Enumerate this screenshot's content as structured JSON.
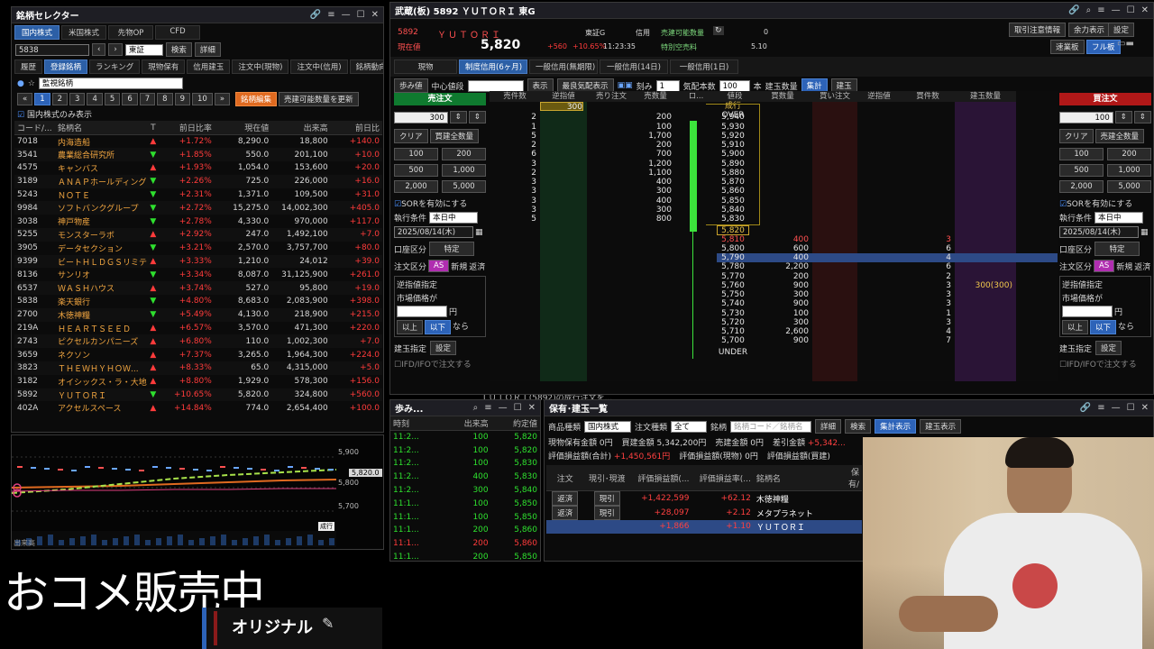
{
  "selector": {
    "title": "銘柄セレクター",
    "markets": [
      "国内株式",
      "米国株式",
      "先物OP",
      "CFD"
    ],
    "code_input": "5838",
    "exchange": "東証",
    "search_btn": "検索",
    "detail_btn": "詳細",
    "subtabs": [
      "履歴",
      "登録銘柄",
      "ランキング",
      "現物保有",
      "信用建玉",
      "注文中(現物)",
      "注文中(信用)",
      "銘柄動向速報"
    ],
    "list_name": "監視銘柄",
    "pages": [
      "1",
      "2",
      "3",
      "4",
      "5",
      "6",
      "7",
      "8",
      "9",
      "10"
    ],
    "edit_btn": "銘柄編集",
    "update_btn": "売建可能数量を更新",
    "domestic_only": "国内株式のみ表示",
    "columns": [
      "コード/...",
      "銘柄名",
      "T",
      "前日比率",
      "現在値",
      "出来高",
      "前日比"
    ],
    "rows": [
      {
        "code": "7018",
        "name": "内海造船",
        "t": "up",
        "pct": "+1.72%",
        "price": "8,290.0",
        "vol": "18,800",
        "chg": "+140.0"
      },
      {
        "code": "3541",
        "name": "農業総合研究所",
        "t": "dn",
        "pct": "+1.85%",
        "price": "550.0",
        "vol": "201,100",
        "chg": "+10.0"
      },
      {
        "code": "4575",
        "name": "キャンバス",
        "t": "up",
        "pct": "+1.93%",
        "price": "1,054.0",
        "vol": "153,600",
        "chg": "+20.0"
      },
      {
        "code": "3189",
        "name": "ＡＮＡＰホールディングス",
        "t": "dn",
        "pct": "+2.26%",
        "price": "725.0",
        "vol": "226,000",
        "chg": "+16.0"
      },
      {
        "code": "5243",
        "name": "ＮＯＴＥ",
        "t": "dn",
        "pct": "+2.31%",
        "price": "1,371.0",
        "vol": "109,500",
        "chg": "+31.0"
      },
      {
        "code": "9984",
        "name": "ソフトバンクグループ",
        "t": "dn",
        "pct": "+2.72%",
        "price": "15,275.0",
        "vol": "14,002,300",
        "chg": "+405.0"
      },
      {
        "code": "3038",
        "name": "神戸物産",
        "t": "dn",
        "pct": "+2.78%",
        "price": "4,330.0",
        "vol": "970,000",
        "chg": "+117.0"
      },
      {
        "code": "5255",
        "name": "モンスターラボ",
        "t": "up",
        "pct": "+2.92%",
        "price": "247.0",
        "vol": "1,492,100",
        "chg": "+7.0"
      },
      {
        "code": "3905",
        "name": "データセクション",
        "t": "dn",
        "pct": "+3.21%",
        "price": "2,570.0",
        "vol": "3,757,700",
        "chg": "+80.0"
      },
      {
        "code": "9399",
        "name": "ビートＨＬＤＧＳリミテ...",
        "t": "up",
        "pct": "+3.33%",
        "price": "1,210.0",
        "vol": "24,012",
        "chg": "+39.0"
      },
      {
        "code": "8136",
        "name": "サンリオ",
        "t": "dn",
        "pct": "+3.34%",
        "price": "8,087.0",
        "vol": "31,125,900",
        "chg": "+261.0"
      },
      {
        "code": "6537",
        "name": "ＷＡＳＨハウス",
        "t": "up",
        "pct": "+3.74%",
        "price": "527.0",
        "vol": "95,800",
        "chg": "+19.0"
      },
      {
        "code": "5838",
        "name": "楽天銀行",
        "t": "dn",
        "pct": "+4.80%",
        "price": "8,683.0",
        "vol": "2,083,900",
        "chg": "+398.0"
      },
      {
        "code": "2700",
        "name": "木徳神糧",
        "t": "dn",
        "pct": "+5.49%",
        "price": "4,130.0",
        "vol": "218,900",
        "chg": "+215.0"
      },
      {
        "code": "219A",
        "name": "ＨＥＡＲＴＳＥＥＤ",
        "t": "up",
        "pct": "+6.57%",
        "price": "3,570.0",
        "vol": "471,300",
        "chg": "+220.0"
      },
      {
        "code": "2743",
        "name": "ピクセルカンパニーズ",
        "t": "up",
        "pct": "+6.80%",
        "price": "110.0",
        "vol": "1,002,300",
        "chg": "+7.0"
      },
      {
        "code": "3659",
        "name": "ネクソン",
        "t": "up",
        "pct": "+7.37%",
        "price": "3,265.0",
        "vol": "1,964,300",
        "chg": "+224.0"
      },
      {
        "code": "3823",
        "name": "ＴＨＥＷＨＹＨＯＷ...",
        "t": "up",
        "pct": "+8.33%",
        "price": "65.0",
        "vol": "4,315,000",
        "chg": "+5.0"
      },
      {
        "code": "3182",
        "name": "オイシックス・ラ・大地",
        "t": "up",
        "pct": "+8.80%",
        "price": "1,929.0",
        "vol": "578,300",
        "chg": "+156.0"
      },
      {
        "code": "5892",
        "name": "ＹＵＴＯＲＩ",
        "t": "dn",
        "pct": "+10.65%",
        "price": "5,820.0",
        "vol": "324,800",
        "chg": "+560.0"
      },
      {
        "code": "402A",
        "name": "アクセルスペース",
        "t": "up",
        "pct": "+14.84%",
        "price": "774.0",
        "vol": "2,654,400",
        "chg": "+100.0"
      }
    ]
  },
  "mini_chart": {
    "price_tag": "5,820.0",
    "ticks": [
      "5,900",
      "5,800",
      "5,700"
    ],
    "marker": "成行",
    "vol_label": "出来高"
  },
  "banner": {
    "main": "おコメ販売中",
    "sub": "オリジナル"
  },
  "board": {
    "title": "武蔵(板) 5892 ＹＵＴＯＲＩ 東G",
    "code": "5892",
    "name": "ＹＵＴＯＲＩ",
    "market": "東証G",
    "margin": "信用",
    "sell_avail_label": "売建可能数量",
    "sell_avail_value": "0",
    "cur_label": "現在値",
    "price": "5,820",
    "chg": "+560",
    "pct": "+10.65%",
    "time": "11:23:35",
    "fee_label": "特別空売料",
    "fee_value": "5.10",
    "top_btns": [
      "取引注意情報",
      "余力表示",
      "設定",
      "速業板",
      "フル板"
    ],
    "order_tabs": [
      "現物",
      "制度信用(6ヶ月)",
      "一般信用(無期限)",
      "一般信用(14日)",
      "一般信用(1日)"
    ],
    "toolbar": {
      "ayumi": "歩み値",
      "center": "中心値段",
      "display": "表示",
      "best": "最良気配表示",
      "tick_label": "刻み",
      "tick": "1",
      "quote_label": "気配本数",
      "quote": "100",
      "quote_unit": "本",
      "pos_label": "建玉数量",
      "summary": "集計",
      "tategyoku": "建玉"
    },
    "sell_panel": {
      "header": "売注文",
      "qty": "300",
      "clear": "クリア",
      "all_btn": "買建全数量",
      "quick": [
        "100",
        "200",
        "500",
        "1,000",
        "2,000",
        "5,000"
      ],
      "sor": "SORを有効にする",
      "cond_label": "執行条件",
      "cond": "本日中",
      "date": "2025/08/14(木)",
      "acct_label": "口座区分",
      "acct": "特定",
      "type_label": "注文区分",
      "as": "AS",
      "new": "新規",
      "ret": "返済",
      "gyaku": "逆指値指定",
      "market_price": "市場価格が",
      "yen": "円",
      "above": "以上",
      "below": "以下",
      "nara": "なら",
      "pos_spec": "建玉指定",
      "setting": "設定",
      "ifd": "IFD/IFOで注文する"
    },
    "buy_panel": {
      "header": "買注文",
      "qty": "100",
      "clear": "クリア",
      "all_btn": "売建全数量",
      "quick": [
        "100",
        "200",
        "500",
        "1,000",
        "2,000",
        "5,000"
      ],
      "sor": "SORを有効にする",
      "cond_label": "執行条件",
      "cond": "本日中",
      "date": "2025/08/14(木)",
      "acct_label": "口座区分",
      "acct": "特定",
      "type_label": "注文区分",
      "as": "AS",
      "new": "新規",
      "ret": "返済",
      "gyaku": "逆指値指定",
      "market_price": "市場価格が",
      "yen": "円",
      "above": "以上",
      "below": "以下",
      "nara": "なら",
      "pos_spec": "建玉指定",
      "setting": "設定",
      "ifd": "IFD/IFOで注文する"
    },
    "columns": [
      "売件数",
      "逆指値",
      "売り注文",
      "売数量",
      "ロ...",
      "値段",
      "買数量",
      "買い注文",
      "逆指値",
      "買件数",
      "建玉数量"
    ],
    "sell_market_qty": "300",
    "market_label": "成行",
    "over": "OVER",
    "under": "UNDER",
    "asks": [
      {
        "cnt": "2",
        "qty": "200",
        "price": "5,940"
      },
      {
        "cnt": "1",
        "qty": "100",
        "price": "5,930"
      },
      {
        "cnt": "5",
        "qty": "1,700",
        "price": "5,920"
      },
      {
        "cnt": "2",
        "qty": "200",
        "price": "5,910"
      },
      {
        "cnt": "6",
        "qty": "700",
        "price": "5,900"
      },
      {
        "cnt": "3",
        "qty": "1,200",
        "price": "5,890"
      },
      {
        "cnt": "2",
        "qty": "1,100",
        "price": "5,880"
      },
      {
        "cnt": "3",
        "qty": "400",
        "price": "5,870"
      },
      {
        "cnt": "3",
        "qty": "300",
        "price": "5,860"
      },
      {
        "cnt": "3",
        "qty": "400",
        "price": "5,850"
      },
      {
        "cnt": "3",
        "qty": "300",
        "price": "5,840"
      },
      {
        "cnt": "5",
        "qty": "800",
        "price": "5,830"
      }
    ],
    "current_price_row": "5,820",
    "bids": [
      {
        "price": "5,810",
        "qty": "400",
        "cnt": "3",
        "pos": ""
      },
      {
        "price": "5,800",
        "qty": "600",
        "cnt": "6",
        "pos": ""
      },
      {
        "price": "5,790",
        "qty": "400",
        "cnt": "4",
        "pos": ""
      },
      {
        "price": "5,780",
        "qty": "2,200",
        "cnt": "6",
        "pos": ""
      },
      {
        "price": "5,770",
        "qty": "200",
        "cnt": "2",
        "pos": ""
      },
      {
        "price": "5,760",
        "qty": "900",
        "cnt": "3",
        "pos": "300(300)"
      },
      {
        "price": "5,750",
        "qty": "300",
        "cnt": "3",
        "pos": ""
      },
      {
        "price": "5,740",
        "qty": "900",
        "cnt": "3",
        "pos": ""
      },
      {
        "price": "5,730",
        "qty": "100",
        "cnt": "1",
        "pos": ""
      },
      {
        "price": "5,720",
        "qty": "300",
        "cnt": "3",
        "pos": ""
      },
      {
        "price": "5,710",
        "qty": "2,600",
        "cnt": "4",
        "pos": ""
      },
      {
        "price": "5,700",
        "qty": "900",
        "cnt": "7",
        "pos": ""
      }
    ]
  },
  "ticker_banner": "ＴＵＴＯＲＩ(5892)の成行注文を...",
  "ayumi": {
    "title": "歩み...",
    "columns": [
      "時刻",
      "出来高",
      "約定値"
    ],
    "rows": [
      {
        "time": "11:2...",
        "vol": "100",
        "price": "5,820",
        "dir": "dn"
      },
      {
        "time": "11:2...",
        "vol": "100",
        "price": "5,820",
        "dir": "dn"
      },
      {
        "time": "11:2...",
        "vol": "100",
        "price": "5,830",
        "dir": "dn"
      },
      {
        "time": "11:2...",
        "vol": "400",
        "price": "5,830",
        "dir": "dn"
      },
      {
        "time": "11:2...",
        "vol": "300",
        "price": "5,840",
        "dir": "dn"
      },
      {
        "time": "11:1...",
        "vol": "100",
        "price": "5,850",
        "dir": "dn"
      },
      {
        "time": "11:1...",
        "vol": "100",
        "price": "5,850",
        "dir": "dn"
      },
      {
        "time": "11:1...",
        "vol": "200",
        "price": "5,860",
        "dir": "dn"
      },
      {
        "time": "11:1...",
        "vol": "200",
        "price": "5,860",
        "dir": "up"
      },
      {
        "time": "11:1...",
        "vol": "200",
        "price": "5,850",
        "dir": "dn"
      }
    ]
  },
  "positions": {
    "title": "保有･建玉一覧",
    "product_label": "商品種類",
    "product": "国内株式",
    "order_type_label": "注文種類",
    "order_type": "全て",
    "stock_label": "銘柄",
    "stock_placeholder": "銘柄コード／銘柄名",
    "detail": "詳細",
    "search": "検索",
    "summary_btn": "集計表示",
    "tate_btn": "建玉表示",
    "summary_line1": [
      {
        "label": "現物保有金額",
        "value": "0円"
      },
      {
        "label": "買建金額",
        "value": "5,342,200円"
      },
      {
        "label": "売建金額",
        "value": "0円"
      },
      {
        "label": "差引金額",
        "value": "+5,342..."
      }
    ],
    "summary_line2": [
      {
        "label": "評価損益額(合計)",
        "value": "+1,450,561円"
      },
      {
        "label": "評価損益額(現物)",
        "value": "0円"
      },
      {
        "label": "評価損益額(買建)",
        "value": ""
      }
    ],
    "columns": [
      "注文",
      "現引･現渡",
      "評価損益額(...",
      "評価損益率(...",
      "銘柄名",
      "保有/"
    ],
    "rows": [
      {
        "ret": "返済",
        "gen": "現引",
        "pl": "+1,422,599",
        "rate": "+62.12",
        "name": "木徳神糧"
      },
      {
        "ret": "返済",
        "gen": "現引",
        "pl": "+28,097",
        "rate": "+2.12",
        "name": "メタプラネット"
      },
      {
        "ret": "",
        "gen": "",
        "pl": "+1,866",
        "rate": "+1.10",
        "name": "ＹＵＴＯＲＩ"
      }
    ]
  },
  "colors": {
    "up": "#ff3b3b",
    "down": "#2ee02e",
    "accent": "#2c5fa6",
    "orange": "#e06a20",
    "sell": "#0f7a2f",
    "buy": "#b01818"
  }
}
